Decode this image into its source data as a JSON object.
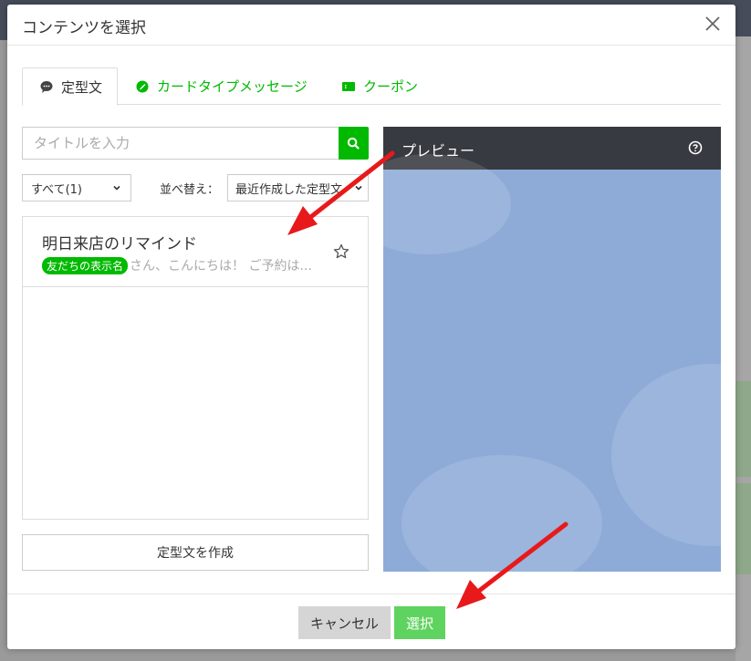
{
  "modal": {
    "title": "コンテンツを選択"
  },
  "tabs": [
    {
      "label": "定型文",
      "icon": "speech-bubble-icon",
      "active": true
    },
    {
      "label": "カードタイプメッセージ",
      "icon": "card-message-icon",
      "active": false
    },
    {
      "label": "クーポン",
      "icon": "coupon-icon",
      "active": false
    }
  ],
  "search": {
    "placeholder": "タイトルを入力"
  },
  "filter": {
    "selected": "すべて(1)"
  },
  "sort": {
    "label": "並べ替え：",
    "selected": "最近作成した定型文"
  },
  "list": {
    "items": [
      {
        "title": "明日来店のリマインド",
        "tag": "友だちの表示名",
        "preview": "さん、こんにちは！ ご予約は..."
      }
    ]
  },
  "create_button": "定型文を作成",
  "preview": {
    "title": "プレビュー"
  },
  "footer": {
    "cancel_label": "キャンセル",
    "select_label": "選択"
  },
  "colors": {
    "accent": "#00b900",
    "select_button": "#5fd35f",
    "preview_bg": "#8eabd8",
    "preview_header": "#373a40",
    "annotation_arrow": "#e8191b"
  }
}
